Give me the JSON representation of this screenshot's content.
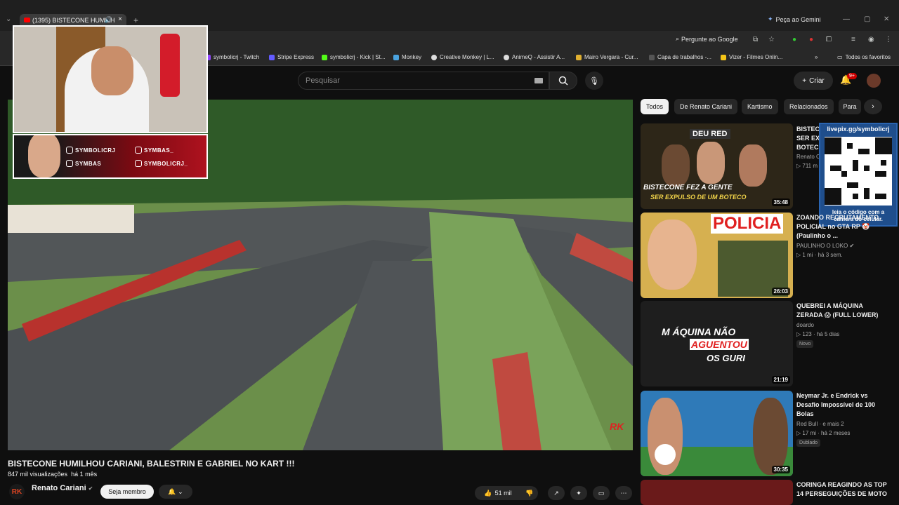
{
  "browser": {
    "tab_title": "(1395) BISTECONE HUMILH",
    "gemini_label": "Peça ao Gemini",
    "google_label": "Pergunte ao Google",
    "bookmarks": [
      "symbolicrj - Twitch",
      "Stripe Express",
      "symbolicrj - Kick | St...",
      "Monkey",
      "Creative Monkey | L...",
      "AnimeQ - Assistir A...",
      "Mairo Vergara - Cur...",
      "Capa de trabalhos -...",
      "Vizer - Filmes Onlin..."
    ],
    "all_bookmarks": "Todos os favoritos"
  },
  "youtube": {
    "search_placeholder": "Pesquisar",
    "create_label": "Criar",
    "notif_badge": "9+"
  },
  "overlay": {
    "twitch": "SYMBOLICRJ",
    "tiktok": "SYMBAS_",
    "youtube": "SYMBAS",
    "instagram": "SYMBOLICRJ_",
    "qr_top": "livepix.gg/symbolicrj",
    "qr_bottom": "leia o código com a câmera do celular."
  },
  "video": {
    "title": "BISTECONE HUMILHOU CARIANI, BALESTRIN E GABRIEL NO KART !!!",
    "views": "847 mil visualizações",
    "age": "há 1 mês",
    "channel": "Renato Cariani",
    "member_label": "Seja membro",
    "likes": "51 mil",
    "watermark": "RK"
  },
  "chips": [
    "Todos",
    "De Renato Cariani",
    "Kartismo",
    "Relacionados",
    "Para"
  ],
  "recommendations": [
    {
      "title": "BISTECONE FEZ A GENTE SER EXPULSO DE UM BOTECO",
      "title_visible": "BISTEC SER EX BOTEC",
      "channel": "Renato C",
      "stats": "711 m",
      "duration": "35:48",
      "thumb_top": "DEU RED",
      "thumb_text1": "BISTECONE FEZ A GENTE",
      "thumb_text2": "SER EXPULSO DE UM BOTECO"
    },
    {
      "title": "ZOANDO RECRUTAMENTO POLICIAL no GTA RP 🤡 (Paulinho o ...",
      "channel": "PAULINHO O LOKO",
      "stats": "1 mi · há 3 sem.",
      "duration": "26:03",
      "thumb_text": "POLICIA"
    },
    {
      "title": "QUEBREI A MÁQUINA ZERADA 😱 (FULL LOWER)",
      "channel": "doardo",
      "stats": "123 · há 5 dias",
      "tag": "Novo",
      "duration": "21:19",
      "thumb_text1": "M ÁQUINA NÃO",
      "thumb_text2": "AGUENTOU",
      "thumb_text3": "OS GURI"
    },
    {
      "title": "Neymar Jr. e Endrick vs Desafio Impossível de 100 Bolas",
      "channel": "Red Bull · e mais 2",
      "stats": "17 mi · há 2 meses",
      "tag": "Dublado",
      "duration": "30:35"
    },
    {
      "title": "CORINGA REAGINDO AS TOP 14 PERSEGUIÇÕES DE MOTO"
    }
  ],
  "colors": {
    "bg": "#0f0f0f",
    "chip": "#272727",
    "accent_red": "#cc0000"
  }
}
